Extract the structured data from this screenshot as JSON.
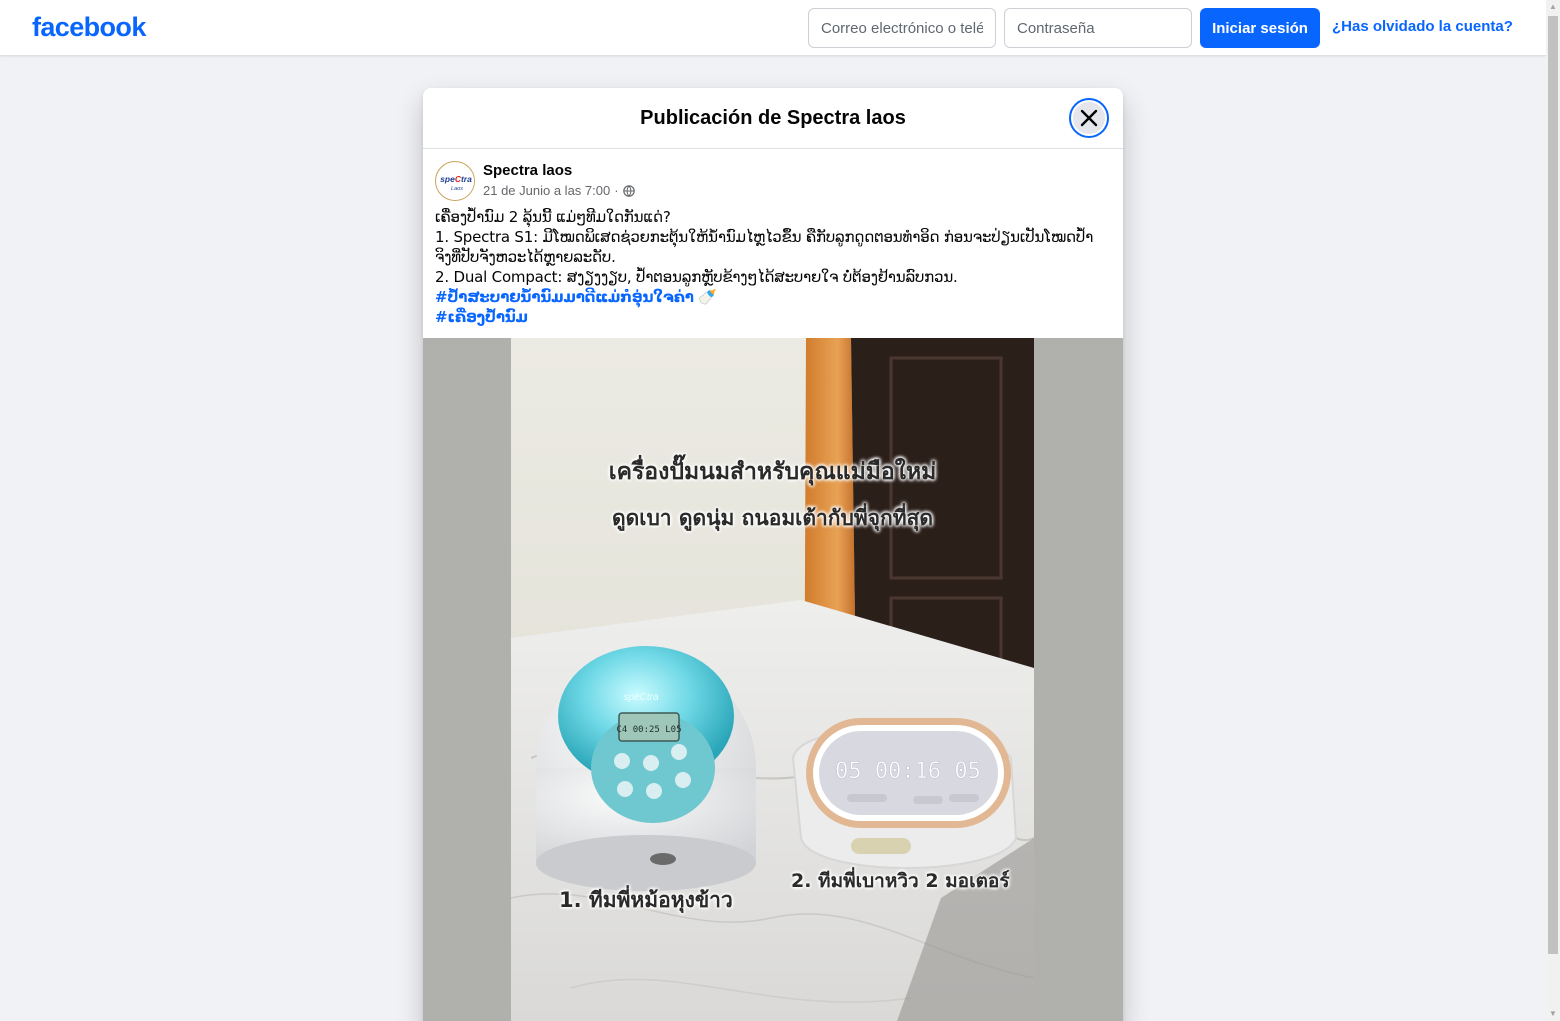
{
  "brand": {
    "logo_text": "facebook",
    "accent": "#0866ff"
  },
  "login": {
    "email_placeholder": "Correo electrónico o teléfono",
    "password_placeholder": "Contraseña",
    "login_label": "Iniciar sesión",
    "forgot_label": "¿Has olvidado la cuenta?"
  },
  "modal": {
    "title": "Publicación de Spectra laos"
  },
  "post": {
    "author": "Spectra laos",
    "avatar_text": "speCtra Laos",
    "date": "21 de Junio a las 7:00",
    "separator": "·",
    "visibility_icon": "globe-icon",
    "lines": [
      "ເຄື່ອງປ້ຳນົມ 2 ລຸ້ນນີ້ ແມ່ໆທີມໃດກັນແດ່?",
      "1. Spectra S1: ມີໂໝດພິເສດຊ່ວຍກະຕຸ້ນໃຫ້ນ້ຳນົມໄຫຼໄວຂຶ້ນ ຄືກັບລູກດູດຕອນທຳອິດ ກ່ອນຈະປ່ຽນເປັນໂໝດປ້ຳ",
      "ຈິງທີ່ປັບຈັງຫວະໄດ້ຫຼາຍລະດັບ.",
      "2. Dual Compact: ສງຽງງຽບ, ປ້ຳຕອນລູກຫຼັບຂ້າງໆໄດ້ສະບາຍໃຈ ບໍ່ຕ້ອງຢ້ານລົບກວນ."
    ],
    "hashtag1": "#ປ້ຳສະບາຍນ້ຳນົມມາດີແມ່ກໍອຸ່ນໃຈຄ່າ",
    "hashtag1_emoji": "🍼",
    "hashtag2": "#ເຄື່ອງປ້ຳນົມ"
  },
  "photo": {
    "caption_line1": "เครื่องปั๊มนมสำหรับคุณแม่มือใหม่",
    "caption_line2": "ดูดเบา ดูดนุ่ม ถนอมเต้ากับพี่จุกที่สุด",
    "label_left": "1. ทีมพี่หม้อหุงข้าว",
    "label_right": "2. ทีมพี่เบาหวิว 2 มอเตอร์",
    "device_left_brand": "speCtra",
    "device_left_display": "C4 00:25 L05",
    "device_right_display": "05  00:16  05"
  }
}
